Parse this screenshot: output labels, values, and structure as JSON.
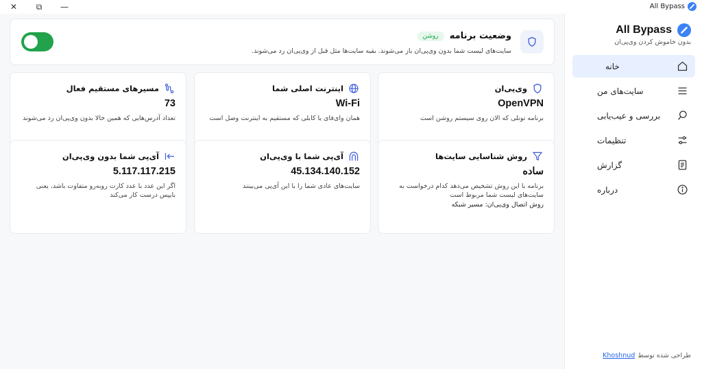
{
  "titlebar": {
    "app_title": "All Bypass",
    "close_symbol": "✕",
    "restore_symbol": "⧉",
    "minimize_symbol": "—"
  },
  "sidebar": {
    "brand_name": "All Bypass",
    "brand_subtitle": "بدون خاموش کردن وی‌پی‌ان",
    "items": [
      {
        "label": "خانه",
        "icon": "home-icon",
        "active": true
      },
      {
        "label": "سایت‌های من",
        "icon": "list-icon",
        "active": false
      },
      {
        "label": "بررسی و عیب‌یابی",
        "icon": "search-icon",
        "active": false
      },
      {
        "label": "تنظیمات",
        "icon": "sliders-icon",
        "active": false
      },
      {
        "label": "گزارش",
        "icon": "document-icon",
        "active": false
      },
      {
        "label": "درباره",
        "icon": "info-icon",
        "active": false
      }
    ],
    "footer_text": "طراحی شده توسط",
    "footer_link": "Khoshnud"
  },
  "status": {
    "title": "وضعیت برنامه",
    "badge": "روشن",
    "description": "سایت‌های لیست شما بدون وی‌پی‌ان باز می‌شوند. بقیه سایت‌ها مثل قبل از وی‌پی‌ان رد می‌شوند.",
    "toggle_on": true
  },
  "cards": [
    {
      "title": "وی‌پی‌ان",
      "value": "OpenVPN",
      "description": "برنامه تونلی که الان روی سیستم روشن است",
      "icon": "shield-icon"
    },
    {
      "title": "اینترنت اصلی شما",
      "value": "Wi-Fi",
      "description": "همان وای‌فای یا کابلی که مستقیم به اینترنت وصل است",
      "icon": "globe-icon"
    },
    {
      "title": "مسیرهای مستقیم فعال",
      "value": "73",
      "description": "تعداد آدرس‌هایی که همین حالا بدون وی‌پی‌ان رد می‌شوند",
      "icon": "route-icon"
    },
    {
      "title": "روش شناسایی سایت‌ها",
      "value": "ساده",
      "description": "برنامه با این روش تشخیص می‌دهد کدام درخواست به سایت‌های لیست شما مربوط است",
      "extra": "روش اتصال وی‌پی‌ان: مسیر شبکه",
      "icon": "filter-icon"
    },
    {
      "title": "آی‌پی شما با وی‌پی‌ان",
      "value": "45.134.140.152",
      "description": "سایت‌های عادی شما را با این آی‌پی می‌بینند",
      "icon": "tunnel-icon"
    },
    {
      "title": "آی‌پی شما بدون وی‌پی‌ان",
      "value": "5.117.117.215",
      "description": "اگر این عدد با عدد کارت روبه‌رو متفاوت باشد، یعنی بایپس درست کار می‌کند",
      "icon": "arrow-left-bar-icon"
    }
  ],
  "colors": {
    "accent": "#3b82f6",
    "toggle_on": "#22a24a",
    "active_nav_bg": "#e8efff",
    "badge_green": "#16a34a"
  }
}
